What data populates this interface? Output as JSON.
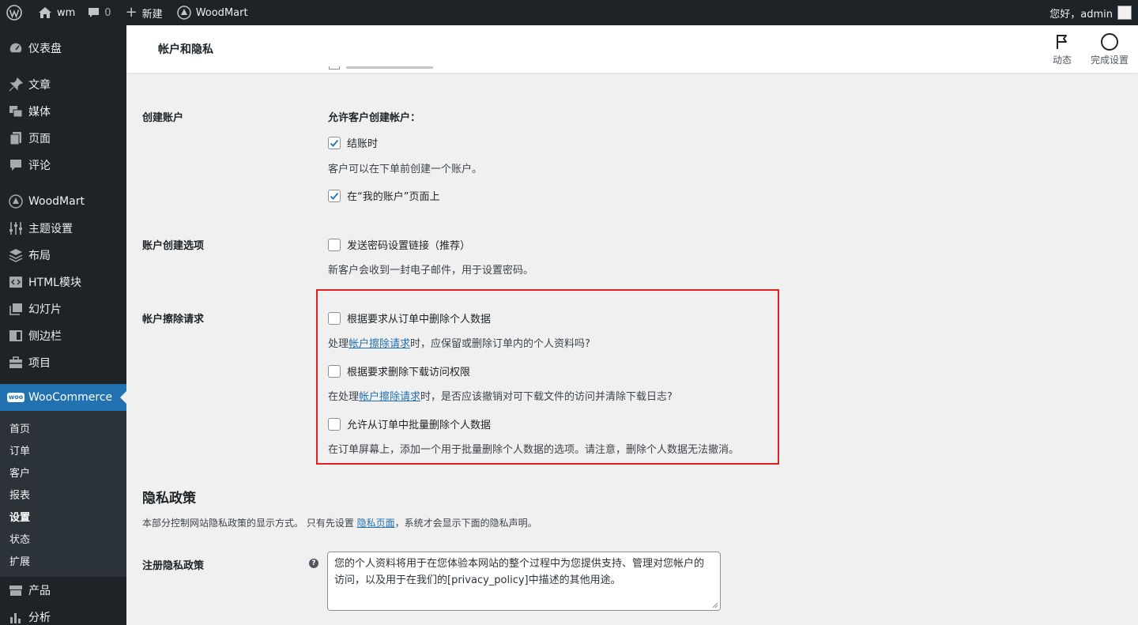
{
  "adminbar": {
    "site_name": "wm",
    "comments_count": "0",
    "new_label": "新建",
    "theme_name": "WoodMart",
    "greeting": "您好，admin"
  },
  "sidebar": {
    "items": [
      {
        "label": "仪表盘",
        "icon": "dashboard-icon"
      },
      {
        "label": "文章",
        "icon": "pin-icon"
      },
      {
        "label": "媒体",
        "icon": "media-icon"
      },
      {
        "label": "页面",
        "icon": "page-icon"
      },
      {
        "label": "评论",
        "icon": "comment-icon"
      },
      {
        "label": "WoodMart",
        "icon": "woodmart-icon"
      },
      {
        "label": "主题设置",
        "icon": "sliders-icon"
      },
      {
        "label": "布局",
        "icon": "layers-icon"
      },
      {
        "label": "HTML模块",
        "icon": "html-icon"
      },
      {
        "label": "幻灯片",
        "icon": "slides-icon"
      },
      {
        "label": "侧边栏",
        "icon": "sidebar-icon"
      },
      {
        "label": "项目",
        "icon": "briefcase-icon"
      },
      {
        "label": "WooCommerce",
        "icon": "woo-icon"
      }
    ],
    "woo_badge": "woo",
    "submenu": [
      "首页",
      "订单",
      "客户",
      "报表",
      "设置",
      "状态",
      "扩展"
    ],
    "bottom": [
      {
        "label": "产品",
        "icon": "products-icon"
      },
      {
        "label": "分析",
        "icon": "analytics-icon"
      }
    ]
  },
  "header": {
    "title": "帐户和隐私",
    "activity_label": "动态",
    "finish_label": "完成设置"
  },
  "account_creation": {
    "label": "创建账户",
    "title": "允许客户创建帐户：",
    "checkout_label": "结账时",
    "checkout_checked": true,
    "checkout_desc": "客户可以在下单前创建一个账户。",
    "myaccount_label": "在“我的账户”页面上",
    "myaccount_checked": true
  },
  "account_options": {
    "label": "账户创建选项",
    "send_link_label": "发送密码设置链接（推荐）",
    "send_link_desc": "新客户会收到一封电子邮件，用于设置密码。"
  },
  "erasure": {
    "label": "帐户擦除请求",
    "opt1_label": "根据要求从订单中删除个人数据",
    "opt1_desc_pre": "处理",
    "opt1_desc_link": "帐户擦除请求",
    "opt1_desc_post": "时，应保留或删除订单内的个人资料吗?",
    "opt2_label": "根据要求删除下载访问权限",
    "opt2_desc_pre": "在处理",
    "opt2_desc_link": "帐户擦除请求",
    "opt2_desc_post": "时，是否应该撤销对可下载文件的访问并清除下载日志?",
    "opt3_label": "允许从订单中批量删除个人数据",
    "opt3_desc": "在订单屏幕上，添加一个用于批量删除个人数据的选项。请注意，删除个人数据无法撤消。"
  },
  "privacy": {
    "heading": "隐私政策",
    "desc_pre": "本部分控制网站隐私政策的显示方式。 只有先设置 ",
    "desc_link": "隐私页面",
    "desc_post": "，系统才会显示下面的隐私声明。",
    "register_label": "注册隐私政策",
    "help_glyph": "?",
    "register_text": "您的个人资料将用于在您体验本网站的整个过程中为您提供支持、管理对您帐户的访问，以及用于在我们的[privacy_policy]中描述的其他用途。"
  },
  "colors": {
    "accent": "#2271b1",
    "highlight_border": "#e0201c",
    "admin_dark": "#1d2327"
  }
}
